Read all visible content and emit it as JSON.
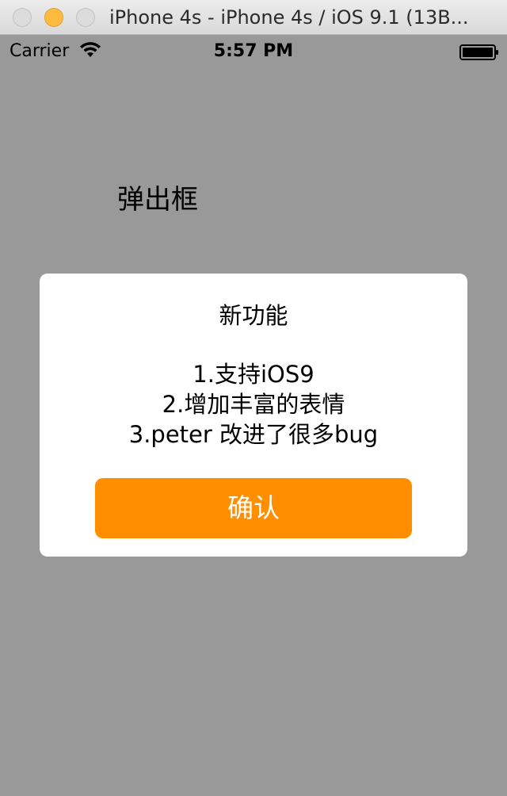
{
  "window": {
    "title": "iPhone 4s - iPhone 4s / iOS 9.1 (13B..."
  },
  "status_bar": {
    "carrier": "Carrier",
    "time": "5:57 PM"
  },
  "page": {
    "label": "弹出框"
  },
  "alert": {
    "title": "新功能",
    "lines": [
      "1.支持iOS9",
      "2.增加丰富的表情",
      "3.peter 改进了很多bug"
    ],
    "confirm_label": "确认"
  },
  "colors": {
    "background": "#999999",
    "confirm_button": "#ff8e00",
    "alert_background": "#ffffff"
  },
  "icons": [
    "close-icon",
    "minimize-icon",
    "zoom-icon",
    "wifi-icon",
    "battery-icon"
  ]
}
